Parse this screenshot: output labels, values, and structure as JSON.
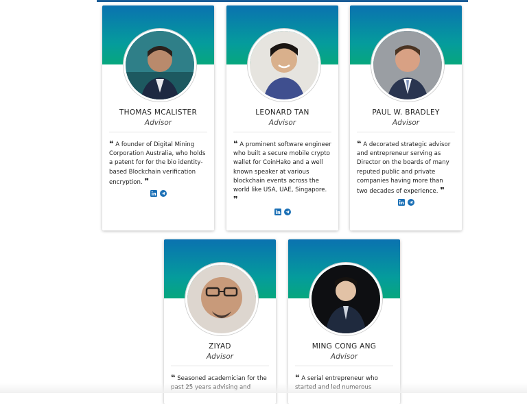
{
  "advisors": [
    {
      "name": "THOMAS MCALISTER",
      "role": "Advisor",
      "quote": "A founder of Digital Mining Corporation Australia, who holds a patent for for the bio identity-based Blockchain verification encryption.",
      "social_icons": [
        "linkedin-icon",
        "telegram-icon"
      ]
    },
    {
      "name": "LEONARD TAN",
      "role": "Advisor",
      "quote": "A prominent software engineer who built a secure mobile crypto wallet for CoinHako and a well known speaker at various blockchain events across the world like USA, UAE, Singapore.",
      "social_icons": [
        "linkedin-icon",
        "telegram-icon"
      ]
    },
    {
      "name": "PAUL W. BRADLEY",
      "role": "Advisor",
      "quote": "A decorated strategic advisor and entrepreneur serving as Director on the boards of many reputed public and private companies having more than two decades of experience.",
      "social_icons": [
        "linkedin-icon",
        "telegram-icon"
      ]
    },
    {
      "name": "ZIYAD",
      "role": "Advisor",
      "quote": "Seasoned academician for the past 25 years advising and",
      "social_icons": []
    },
    {
      "name": "MING CONG ANG",
      "role": "Advisor",
      "quote": "A serial entrepreneur who started and led numerous",
      "social_icons": []
    }
  ],
  "colors": {
    "header_gradient_top": "#0a72b0",
    "header_gradient_bottom": "#07a77e",
    "icon_color": "#1a6fb5",
    "top_bar": "#1b5d97"
  }
}
